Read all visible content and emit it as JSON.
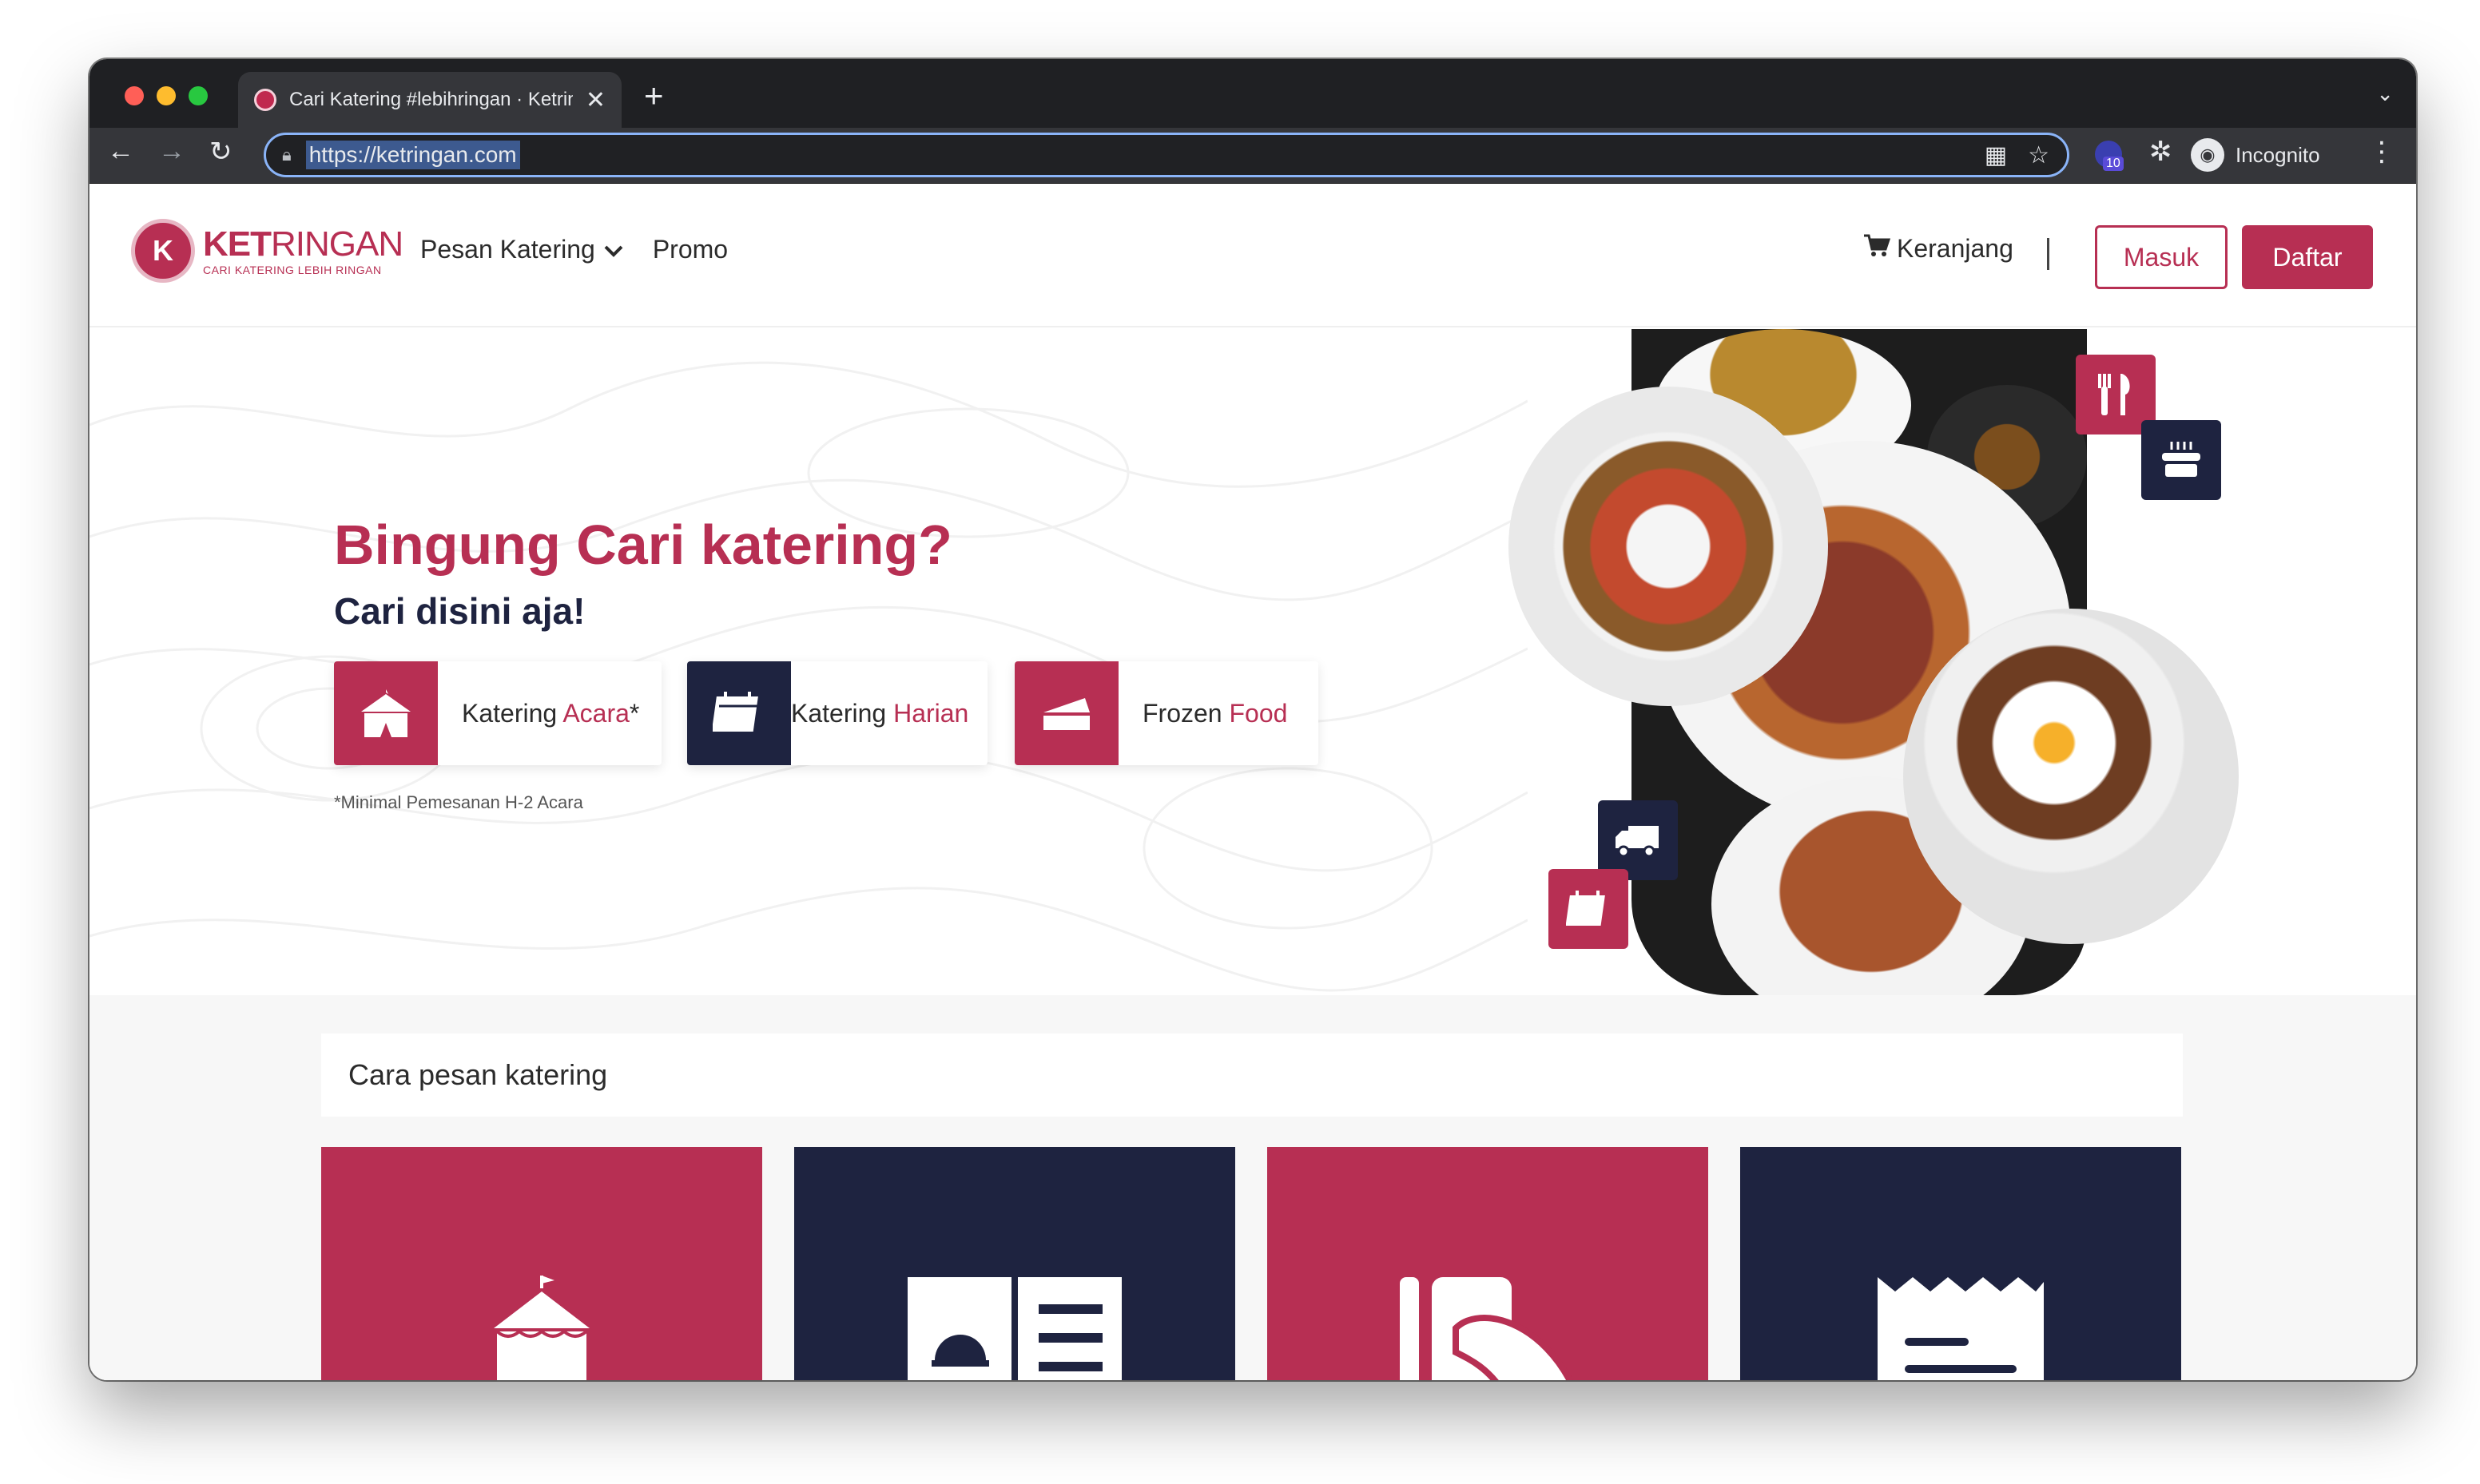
{
  "browser": {
    "tab_title": "Cari Katering #lebihringan · Ketringan",
    "tab_close": "✕",
    "new_tab": "+",
    "url": "https://ketringan.com",
    "extension_badge": "10",
    "profile_label": "Incognito"
  },
  "header": {
    "logo_word_bold": "KET",
    "logo_word_rest": "RINGAN",
    "logo_tagline": "CARI KATERING LEBIH RINGAN",
    "nav": [
      {
        "label": "Pesan Katering"
      },
      {
        "label": "Promo"
      }
    ],
    "cart_label": "Keranjang",
    "login_label": "Masuk",
    "register_label": "Daftar"
  },
  "hero": {
    "title": "Bingung Cari katering?",
    "subtitle": "Cari disini aja!",
    "categories": [
      {
        "prefix": "Katering ",
        "accent": "Acara",
        "suffix": "*",
        "icon": "tent-icon"
      },
      {
        "prefix": "Katering ",
        "accent": "Harian",
        "suffix": "",
        "icon": "calendar-icon"
      },
      {
        "prefix": "Frozen ",
        "accent": "Food",
        "suffix": "",
        "icon": "cake-slice-icon"
      }
    ],
    "note": "*Minimal Pemesanan H-2 Acara"
  },
  "steps": {
    "title": "Cara pesan katering"
  },
  "colors": {
    "primary": "#b72f53",
    "navy": "#1e2340",
    "section_bg": "#f7f7f7"
  }
}
